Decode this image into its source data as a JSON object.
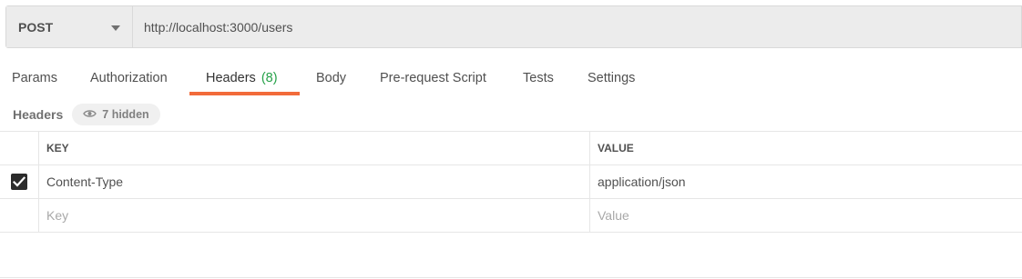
{
  "request": {
    "method": "POST",
    "url": "http://localhost:3000/users"
  },
  "tabs": [
    {
      "label": "Params"
    },
    {
      "label": "Authorization"
    },
    {
      "label": "Headers",
      "count": "(8)",
      "active": true
    },
    {
      "label": "Body"
    },
    {
      "label": "Pre-request Script"
    },
    {
      "label": "Tests"
    },
    {
      "label": "Settings"
    }
  ],
  "headers_section": {
    "title": "Headers",
    "hidden_label": "7 hidden"
  },
  "table": {
    "columns": [
      "KEY",
      "VALUE"
    ],
    "rows": [
      {
        "checked": true,
        "key": "Content-Type",
        "value": "application/json"
      }
    ],
    "placeholder": {
      "key": "Key",
      "value": "Value"
    }
  },
  "colors": {
    "accent": "#f26b3a",
    "count_green": "#25a148"
  },
  "icons": {
    "method_dropdown": "chevron-down-icon",
    "hidden_toggle": "eye-icon",
    "checkbox": "checkmark-icon"
  }
}
